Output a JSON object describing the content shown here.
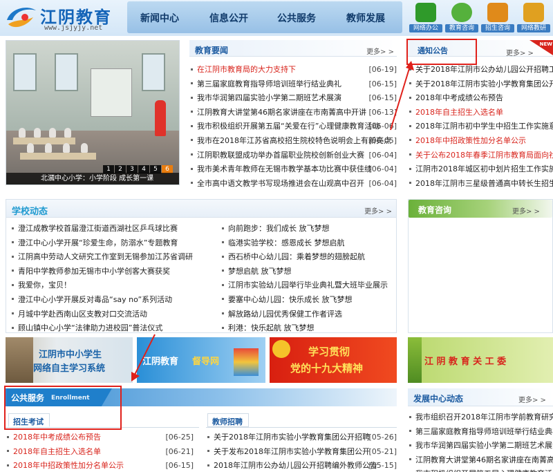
{
  "site": {
    "title": "江阴教育",
    "url": "www.jsjyjy.net"
  },
  "nav": [
    "新闻中心",
    "信息公开",
    "公共服务",
    "教师发展"
  ],
  "quick_links": [
    {
      "label": "网络办公",
      "icon": "office-icon",
      "color": "#2f9a2a"
    },
    {
      "label": "教育咨询",
      "icon": "chat-icon",
      "color": "#55b13c"
    },
    {
      "label": "招生咨询",
      "icon": "admission-icon",
      "color": "#e08a1a"
    },
    {
      "label": "网络教研",
      "icon": "research-icon",
      "color": "#e0a020"
    }
  ],
  "slideshow": {
    "pages": [
      "1",
      "2",
      "3",
      "4",
      "5",
      "6"
    ],
    "active": 5,
    "caption": "北漍中心小学：小学阶段 成长第一课"
  },
  "news": {
    "title": "教育要闻",
    "more": "更多> >",
    "items": [
      {
        "text": "在江阴市教育局的大力支持下",
        "date": "[06-19]",
        "red": true
      },
      {
        "text": "第三届家庭教育指导师培训班举行结业典礼",
        "date": "[06-15]",
        "red": false
      },
      {
        "text": "我市华润第四届实验小学第二期班艺术展演",
        "date": "[06-15]",
        "red": false
      },
      {
        "text": "江阴教育大讲堂第46期名家讲座在市南菁高中开讲",
        "date": "[06-13]",
        "red": false
      },
      {
        "text": "我市积极组织开展第五届“关爱在行”心理健康教育活动",
        "date": "[06-06]",
        "red": false
      },
      {
        "text": "我市在2018年江苏省高校招生院校特色说明会上有新亮点",
        "date": "[06-05]",
        "red": false
      },
      {
        "text": "江阴职教联盟成功举办首届职业院校创新创业大赛",
        "date": "[06-04]",
        "red": false
      },
      {
        "text": "我市美术青年教师在无锡市教学基本功比赛中获佳绩",
        "date": "[06-04]",
        "red": false
      },
      {
        "text": "全市高中语文教学书写现场推进会在山观高中召开",
        "date": "[06-04]",
        "red": false
      }
    ]
  },
  "notice": {
    "title": "通知公告",
    "more": "更多> >",
    "badge": "NEW",
    "items": [
      {
        "text": "关于2018年江阴市公办幼儿园公开招聘工作人员",
        "red": false
      },
      {
        "text": "关于2018年江阴市实验小学教育集团公开招聘",
        "red": false
      },
      {
        "text": "2018年中考成绩公布预告",
        "red": false
      },
      {
        "text": "2018年自主招生入选名单",
        "red": true
      },
      {
        "text": "2018年江阴市初中学生中招生工作实施意见",
        "red": false
      },
      {
        "text": "2018年中招政策性加分名单公示",
        "red": true
      },
      {
        "text": "关于公布2018年春季江阴市教育局面向社会",
        "red": true
      },
      {
        "text": "江阴市2018年城区初中划片招生工作实施意见",
        "red": false
      },
      {
        "text": "2018年江阴市三星级普通高中转长生招生简章",
        "red": false
      }
    ]
  },
  "school": {
    "title": "学校动态",
    "more": "更多> >",
    "left": [
      "澄江成教学校首届澄江街道西湖社区乒乓球比赛",
      "澄江中心小学开展“珍爱生命，防溺水”专题教育",
      "江阴高中劳动人文研究工作室到无锡参加江苏省调研",
      "青阳中学教师参加无锡市中小学创客大赛获奖",
      "我爱你，宝贝！",
      "澄江中心小学开展反对毒品“say no”系列活动",
      "月城中学赴西南山区支教对口交流活动",
      "顾山镇中心小学“法律助力进校园”普法仪式"
    ],
    "right": [
      "向前跑步：我们成长 放飞梦想",
      "临港实验学校：感恩成长 梦想启航",
      "西石桥中心幼儿园：乘着梦想的翅膀起航",
      "梦想启航 放飞梦想",
      "江阴市实验幼儿园举行毕业典礼暨大班毕业展示",
      "要塞中心幼儿园：快乐成长 放飞梦想",
      "解放路幼儿园优秀保健工作者评选",
      "利港：快乐起航 放飞梦想"
    ]
  },
  "consult": {
    "title": "教育咨询",
    "more": "更多> >"
  },
  "banners": [
    {
      "line1": "江阴市中小学生",
      "line2": "网络自主学习系统"
    },
    {
      "line1": "江阴教育",
      "line2": "督导网"
    },
    {
      "line1": "学习贯彻",
      "line2": "党的十九大精神"
    },
    {
      "line1": "江 阴 教 育 关 工 委",
      "line2": ""
    }
  ],
  "public": {
    "title": "公共服务",
    "subtitle": "Enrollment",
    "tab1": "招生考试",
    "tab2": "教师招聘",
    "left": [
      {
        "text": "2018年中考成绩公布预告",
        "date": "[06-25]",
        "red": true
      },
      {
        "text": "2018年自主招生入选名单",
        "date": "[06-21]",
        "red": true
      },
      {
        "text": "2018年中招政策性加分名单公示",
        "date": "[06-15]",
        "red": true
      }
    ],
    "right": [
      {
        "text": "关于2018年江阴市实验小学教育集团公开招聘",
        "date": "[05-26]"
      },
      {
        "text": "关于发布2018年江阴市实验小学教育集团公开",
        "date": "[05-21]"
      },
      {
        "text": "2018年江阴市公办幼儿园公开招聘编外教师公告",
        "date": "[05-15]"
      }
    ]
  },
  "dev": {
    "title": "发展中心动态",
    "more": "更多> >",
    "items": [
      "我市组织召开2018年江阴市学前教育研究会年会",
      "第三届家庭教育指导师培训班举行结业典礼",
      "我市华润第四届实验小学第二期班艺术展演",
      "江阴教育大讲堂第46期名家讲座在南菁高中开讲",
      "我市积极组织开展第五届心理健康教育活动"
    ]
  },
  "colors": {
    "accent": "#1464b8",
    "red": "#d8241c",
    "green": "#6bb13a",
    "blue": "#2d86cf"
  }
}
